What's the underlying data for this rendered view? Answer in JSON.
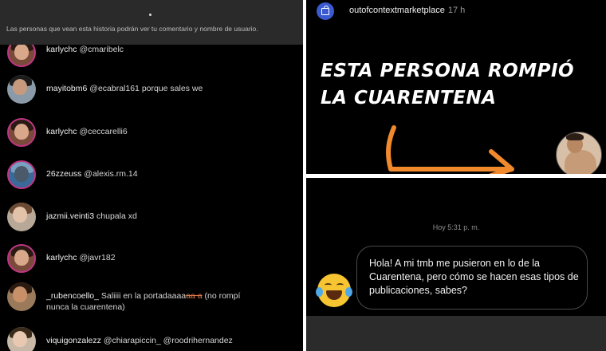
{
  "left_panel": {
    "banner": "Las personas que vean esta historia podrán ver tu comentario y nombre de usuario.",
    "comments": [
      {
        "user": "karlychc",
        "message": "@cmaribelc",
        "avatar": "avatar-karlychc"
      },
      {
        "user": "mayitobm6",
        "message": "@ecabral161  porque sales we",
        "avatar": "avatar-mayitobm6"
      },
      {
        "user": "karlychc",
        "message": "@ceccarelli6",
        "avatar": "avatar-karlychc"
      },
      {
        "user": "26zzeuss",
        "message": "@alexis.rm.14",
        "avatar": "avatar-26zzeuss"
      },
      {
        "user": "jazmii.veinti3",
        "message": "chupala xd",
        "avatar": "avatar-jazmii"
      },
      {
        "user": "karlychc",
        "message": "@javr182",
        "avatar": "avatar-karlychc"
      },
      {
        "user": "_rubencoello_",
        "message": "Saliiii en la portadaaaa",
        "struck": "aa a",
        "message_after": " (no rompí",
        "line2": "nunca la cuarentena)",
        "avatar": "avatar-rubencoello"
      },
      {
        "user": "viquigonzalezz",
        "message": "@chiarapiccin_ @roodrihernandez",
        "avatar": "avatar-viquigonzalezz"
      }
    ]
  },
  "story": {
    "account": "outofcontextmarketplace",
    "time": "17 h",
    "headline_line1": "ESTA PERSONA ROMPIÓ",
    "headline_line2": "LA CUARENTENA",
    "arrow_color": "#f08a2c"
  },
  "dm": {
    "timestamp": "Hoy 5:31 p. m.",
    "message": "Hola! A mi tmb me pusieron en lo de la Cuarentena, pero cómo se hacen esas tipos de publicaciones, sabes?",
    "emoji": "joy-face-emoji"
  },
  "colors": {
    "background": "#000000",
    "story_ring": "#c13584",
    "shop_avatar": "#3a5bd0"
  }
}
